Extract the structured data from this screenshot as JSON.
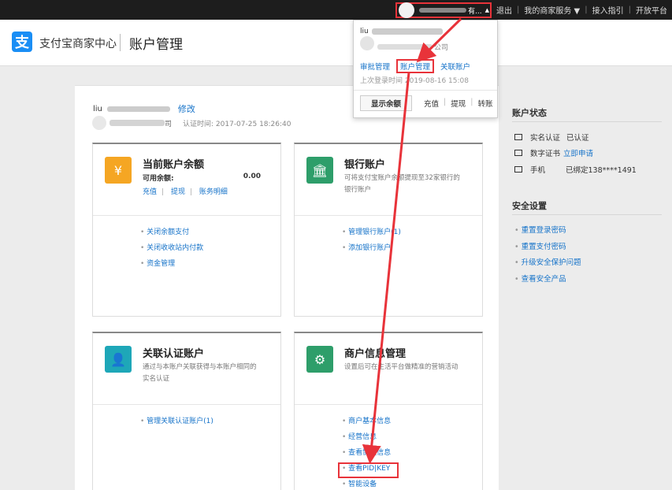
{
  "topbar": {
    "user_name": "有...",
    "caret": "▲",
    "links": [
      "退出",
      "我的商家服务 ▼",
      "接入指引",
      "开放平台"
    ]
  },
  "header": {
    "logo_glyph": "支",
    "logo_text": "支付宝商家中心",
    "page_title": "账户管理"
  },
  "account": {
    "name_prefix": "liu",
    "edit": "修改",
    "name_suffix": "司",
    "cert_label": "认证时间: 2017-07-25 18:26:40"
  },
  "cards": [
    {
      "title": "当前账户余额",
      "balance_label": "可用余额:",
      "balance_value": "0.00",
      "actions": [
        "充值",
        "提现",
        "账务明细"
      ],
      "links": [
        "关闭余额支付",
        "关闭收收站内付款",
        "资金管理"
      ]
    },
    {
      "title": "银行账户",
      "desc": "可将支付宝账户余额提现至32家银行的银行账户",
      "links": [
        "管理银行账户(1)",
        "添加银行账户"
      ]
    },
    {
      "title": "关联认证账户",
      "desc": "通过与本账户关联获得与本账户相同的实名认证",
      "links": [
        "管理关联认证账户(1)"
      ]
    },
    {
      "title": "商户信息管理",
      "desc": "设置后可在生活平台做精准的营销活动",
      "links": [
        "商户基本信息",
        "经营信息",
        "查看协议信息",
        "查看PID|KEY",
        "智能设备"
      ]
    }
  ],
  "right": {
    "status_title": "账户状态",
    "status_items": [
      {
        "label": "实名认证",
        "value": "已认证",
        "link": ""
      },
      {
        "label": "数字证书",
        "value": "",
        "link": "立即申请"
      },
      {
        "label": "手机",
        "value": "已绑定138****1491",
        "link": ""
      }
    ],
    "security_title": "安全设置",
    "security_links": [
      "重置登录密码",
      "重置支付密码",
      "升级安全保护问题",
      "查看安全产品"
    ]
  },
  "popup": {
    "name_prefix": "liu",
    "company_suffix": "公司",
    "links": [
      "审批管理",
      "账户管理",
      "关联账户"
    ],
    "last_login": "上次登录时间 2019-08-16 15:08",
    "show_balance": "显示余额",
    "actions": [
      "充值",
      "提现",
      "转账"
    ]
  },
  "colors": {
    "accent_blue": "#1673c9",
    "highlight_red": "#e8333a",
    "icon_orange": "#f5a623",
    "icon_green": "#2e9e6a",
    "icon_teal": "#1ea7b8"
  }
}
